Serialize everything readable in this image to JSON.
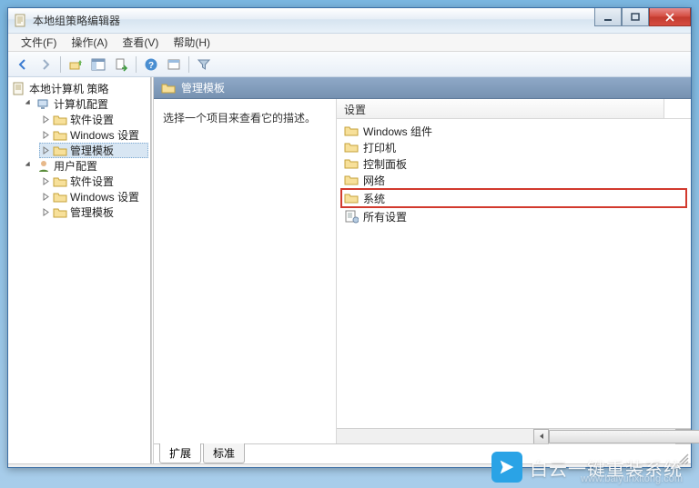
{
  "window_title": "本地组策略编辑器",
  "menu": {
    "file": "文件(F)",
    "action": "操作(A)",
    "view": "查看(V)",
    "help": "帮助(H)"
  },
  "toolbar_icons": {
    "back": "back-icon",
    "fwd": "forward-icon",
    "up": "up-icon",
    "show": "show-hide-tree-icon",
    "export": "export-list-icon",
    "help": "help-icon",
    "props": "properties-icon",
    "filter": "filter-icon"
  },
  "tree": {
    "root": "本地计算机 策略",
    "computer": "计算机配置",
    "user": "用户配置",
    "software": "软件设置",
    "windows": "Windows 设置",
    "templates": "管理模板"
  },
  "header_title": "管理模板",
  "description_hint": "选择一个项目来查看它的描述。",
  "columns": {
    "setting": "设置"
  },
  "items": [
    {
      "label": "Windows 组件",
      "type": "folder"
    },
    {
      "label": "打印机",
      "type": "folder"
    },
    {
      "label": "控制面板",
      "type": "folder"
    },
    {
      "label": "网络",
      "type": "folder"
    },
    {
      "label": "系统",
      "type": "folder",
      "highlight": true
    },
    {
      "label": "所有设置",
      "type": "settings"
    }
  ],
  "tabs": {
    "extended": "扩展",
    "standard": "标准"
  },
  "watermark": {
    "text": "白云一键重装系统",
    "url": "www.baiyunxitong.com"
  },
  "colors": {
    "headerBg": "#7e98b8",
    "closeBtn": "#d44a3e",
    "highlight": "#d23a2e"
  }
}
